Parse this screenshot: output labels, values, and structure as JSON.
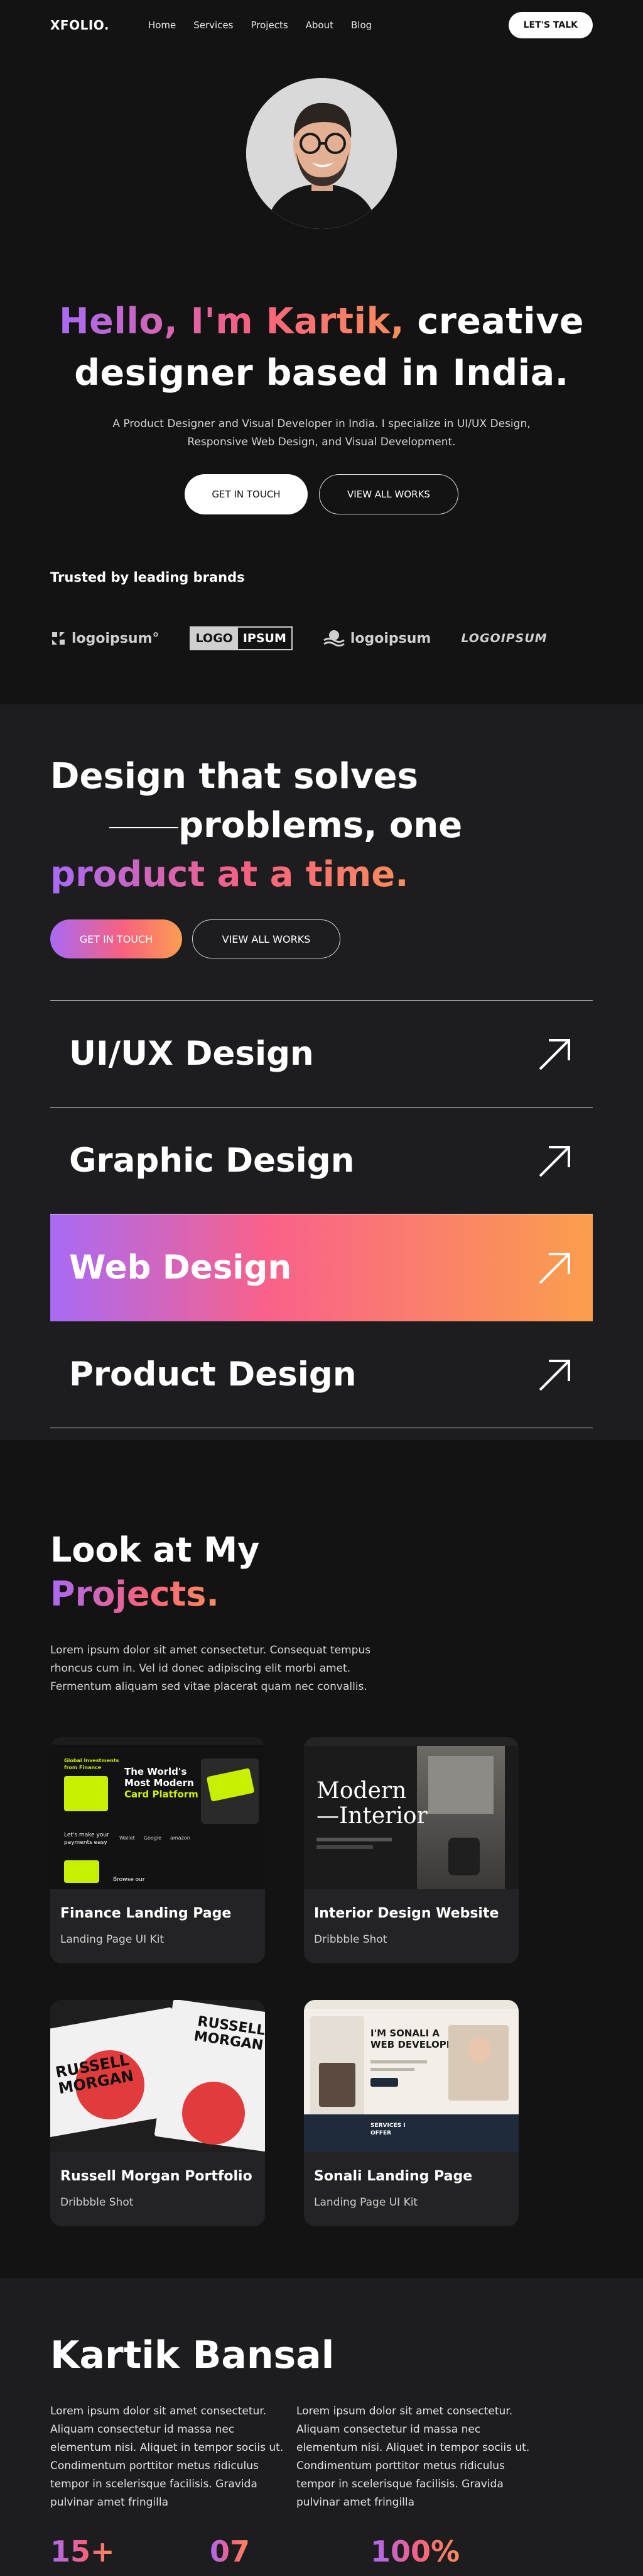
{
  "nav": {
    "logo": "XFOLIO.",
    "links": [
      "Home",
      "Services",
      "Projects",
      "About",
      "Blog"
    ],
    "cta": "LET'S TALK"
  },
  "hero": {
    "title_gradient": "Hello, I'm Kartik,",
    "title_rest_1": " creative",
    "title_line_2": "designer based in India.",
    "subtitle_1": "A Product Designer and Visual Developer in India. I specialize in UI/UX Design,",
    "subtitle_2": "Responsive Web Design, and Visual Development.",
    "btn_primary": "GET IN TOUCH",
    "btn_secondary": "VIEW ALL WORKS"
  },
  "brands": {
    "heading": "Trusted by leading brands",
    "items": [
      "logoipsum°",
      "LOGO",
      "IPSUM",
      "logoipsum",
      "LOGOIPSUM"
    ]
  },
  "services": {
    "title_1": "Design that solves",
    "title_2": "problems, one",
    "title_3": "product at a time.",
    "btn_primary": "GET IN TOUCH",
    "btn_secondary": "VIEW ALL WORKS",
    "items": [
      {
        "label": "UI/UX Design",
        "active": false
      },
      {
        "label": "Graphic Design",
        "active": false
      },
      {
        "label": "Web Design",
        "active": true
      },
      {
        "label": "Product Design",
        "active": false
      }
    ]
  },
  "projects": {
    "title_1": "Look at My",
    "title_2": "Projects.",
    "description": "Lorem ipsum dolor sit amet consectetur. Consequat tempus rhoncus cum in. Vel id donec adipiscing elit morbi amet. Fermentum aliquam sed vitae placerat quam nec convallis.",
    "cards": [
      {
        "title": "Finance Landing Page",
        "subtitle": "Landing Page UI Kit",
        "shot_text": [
          "The World's",
          "Most Modern",
          "Card Platform",
          "Global Investments",
          "from Finance",
          "Let's make your",
          "payments easy",
          "Browse our",
          "Wallet",
          "Google",
          "amazon"
        ]
      },
      {
        "title": "Interior Design Website",
        "subtitle": "Dribbble Shot",
        "shot_text": [
          "Modern",
          "—Interior"
        ]
      },
      {
        "title": "Russell Morgan Portfolio",
        "subtitle": "Dribbble Shot",
        "shot_text": [
          "RUSSELL",
          "MORGAN"
        ]
      },
      {
        "title": "Sonali Landing Page",
        "subtitle": "Landing Page UI Kit",
        "shot_text": [
          "I'M SONALI A",
          "WEB DEVELOPER",
          "SERVICES I",
          "OFFER"
        ]
      }
    ]
  },
  "about": {
    "title": "Kartik Bansal",
    "para_1": "Lorem ipsum dolor sit amet consectetur. Aliquam consectetur id massa nec elementum nisi. Aliquet in tempor sociis ut. Condimentum porttitor metus ridiculus tempor in scelerisque facilisis. Gravida pulvinar amet fringilla",
    "para_2": "Lorem ipsum dolor sit amet consectetur. Aliquam consectetur id massa nec elementum nisi. Aliquet in tempor sociis ut. Condimentum porttitor metus ridiculus tempor in scelerisque facilisis. Gravida pulvinar amet fringilla",
    "stats": [
      "15+",
      "07",
      "100%"
    ]
  },
  "colors": {
    "bg": "#141313",
    "bg_alt": "#1d1c1f",
    "card": "#232225",
    "grad_purple": "#a86af5",
    "grad_pink": "#f7617f",
    "grad_orange": "#fb9e4c",
    "lime": "#c7f000"
  }
}
